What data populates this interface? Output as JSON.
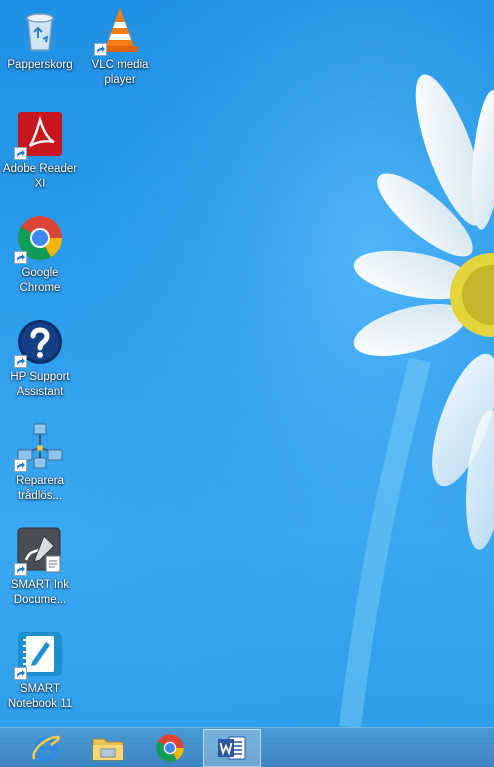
{
  "desktop": {
    "icons": [
      {
        "label": "Papperskorg",
        "icon": "recycle-bin-icon"
      },
      {
        "label": "VLC media\nplayer",
        "icon": "vlc-icon"
      },
      {
        "label": "Adobe Reader\nXI",
        "icon": "adobe-reader-icon"
      },
      {
        "label": "Google\nChrome",
        "icon": "chrome-icon"
      },
      {
        "label": "HP Support\nAssistant",
        "icon": "hp-support-icon"
      },
      {
        "label": "Reparera\ntrådlös...",
        "icon": "network-repair-icon"
      },
      {
        "label": "SMART Ink\nDocume...",
        "icon": "smart-ink-icon"
      },
      {
        "label": "SMART\nNotebook 11",
        "icon": "smart-notebook-icon"
      }
    ]
  },
  "taskbar": {
    "items": [
      {
        "name": "Internet Explorer",
        "icon": "internet-explorer-icon",
        "active": false
      },
      {
        "name": "File Explorer",
        "icon": "file-explorer-icon",
        "active": false
      },
      {
        "name": "Google Chrome",
        "icon": "chrome-icon",
        "active": false
      },
      {
        "name": "Microsoft Word",
        "icon": "word-icon",
        "active": true
      }
    ]
  },
  "colors": {
    "wallpaper": "#2b9cec",
    "taskbar": "#3b86c2",
    "label_text": "#ffffff"
  }
}
